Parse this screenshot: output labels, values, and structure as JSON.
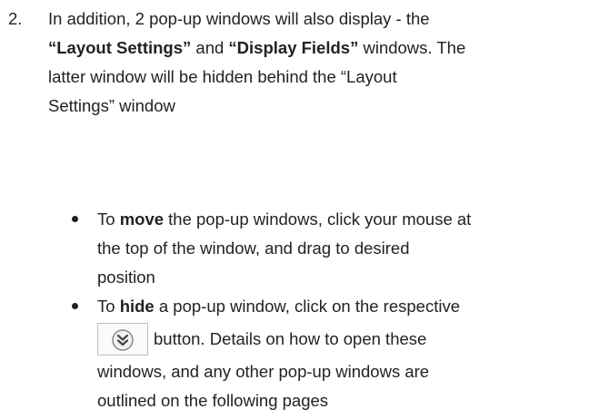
{
  "item_number": "2.",
  "para": {
    "l1": "In addition, 2 pop-up windows will also display - the",
    "l2_b1": "“Layout Settings”",
    "l2_t1": " and ",
    "l2_b2": "“Display Fields”",
    "l2_t2": " windows. The",
    "l3": "latter window will be hidden behind the “Layout",
    "l4": "Settings” window"
  },
  "bullet1": {
    "pre": "To ",
    "bold": "move",
    "post": " the pop-up windows, click your mouse at",
    "l2": "the top of the window, and drag to desired",
    "l3": "position"
  },
  "bullet2": {
    "pre": "To ",
    "bold": "hide",
    "post": " a pop-up window, click on the respective",
    "l2": "button. Details on how to open these",
    "l3": "windows, and any other pop-up windows are",
    "l4": "outlined on the following pages"
  },
  "icons": {
    "hide_button_icon": "double-chevron-down-icon"
  }
}
